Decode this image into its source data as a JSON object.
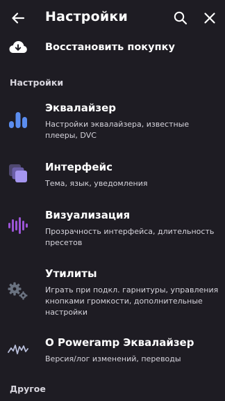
{
  "header": {
    "title": "Настройки"
  },
  "restore": {
    "label": "Восстановить покупку"
  },
  "sections": [
    {
      "label": "Настройки"
    },
    {
      "label": "Другое"
    }
  ],
  "items": [
    {
      "title": "Эквалайзер",
      "subtitle": "Настройки эквалайзера, известные плееры, DVC",
      "icon": "equalizer-icon"
    },
    {
      "title": "Интерфейс",
      "subtitle": "Тема, язык, уведомления",
      "icon": "interface-icon"
    },
    {
      "title": "Визуализация",
      "subtitle": "Прозрачность интерфейса, длительность пресетов",
      "icon": "visualization-icon"
    },
    {
      "title": "Утилиты",
      "subtitle": "Играть при подкл. гарнитуры, управления кнопками громкости, дополнительные настройки",
      "icon": "gears-icon"
    },
    {
      "title": "О Poweramp Эквалайзер",
      "subtitle": "Версия/лог изменений, переводы",
      "icon": "waveform-icon"
    }
  ],
  "colors": {
    "background": "#1e1c23",
    "equalizer_blue": "#5b8def",
    "interface_purple": "#8d7fd6",
    "visualization_purple": "#9b54d6",
    "utility_gray": "#6a7280"
  }
}
